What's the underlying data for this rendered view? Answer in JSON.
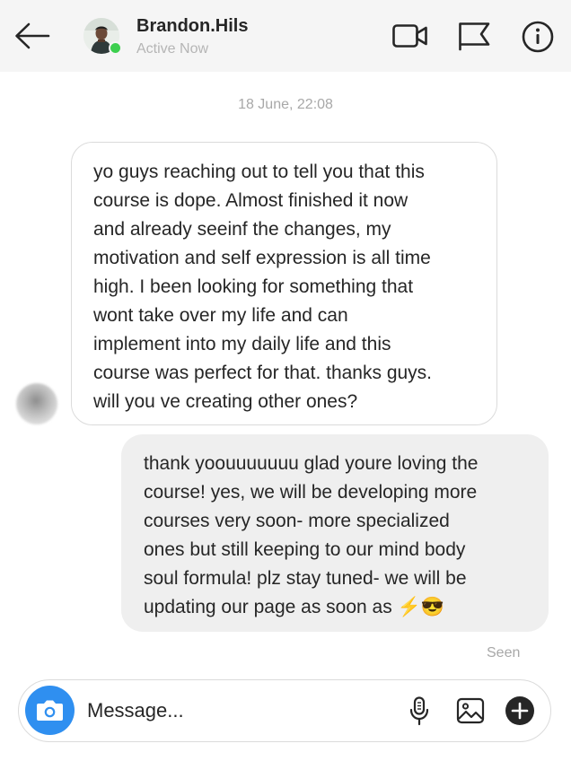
{
  "header": {
    "username": "Brandon.Hils",
    "status": "Active Now",
    "icons": [
      "back-arrow-icon",
      "video-call-icon",
      "flag-icon",
      "info-icon"
    ]
  },
  "conversation": {
    "timestamp": "18 June, 22:08",
    "messages": [
      {
        "direction": "incoming",
        "text": "yo guys reaching out to tell you that this\ncourse is dope. Almost finished it now\nand already seeinf the changes, my\nmotivation and self expression is all time\nhigh. I been looking for something that\nwont take over my life and can\nimplement into my daily life and this\ncourse was perfect for that. thanks guys.\nwill you ve creating other ones?"
      },
      {
        "direction": "outgoing",
        "text": "thank yoouuuuuuu glad youre loving the\ncourse! yes, we will be developing more\ncourses very soon- more specialized\nones but still keeping to our mind body\nsoul formula! plz stay tuned- we will be\nupdating our page as soon as ⚡😎"
      }
    ],
    "seen_label": "Seen"
  },
  "composer": {
    "placeholder": "Message...",
    "icons": [
      "camera-icon",
      "microphone-icon",
      "image-icon",
      "add-icon"
    ]
  },
  "colors": {
    "header_bg": "#f5f5f5",
    "outgoing_bubble": "#efefef",
    "camera_button": "#2f8ff0",
    "online_dot": "#3ccf4e"
  }
}
